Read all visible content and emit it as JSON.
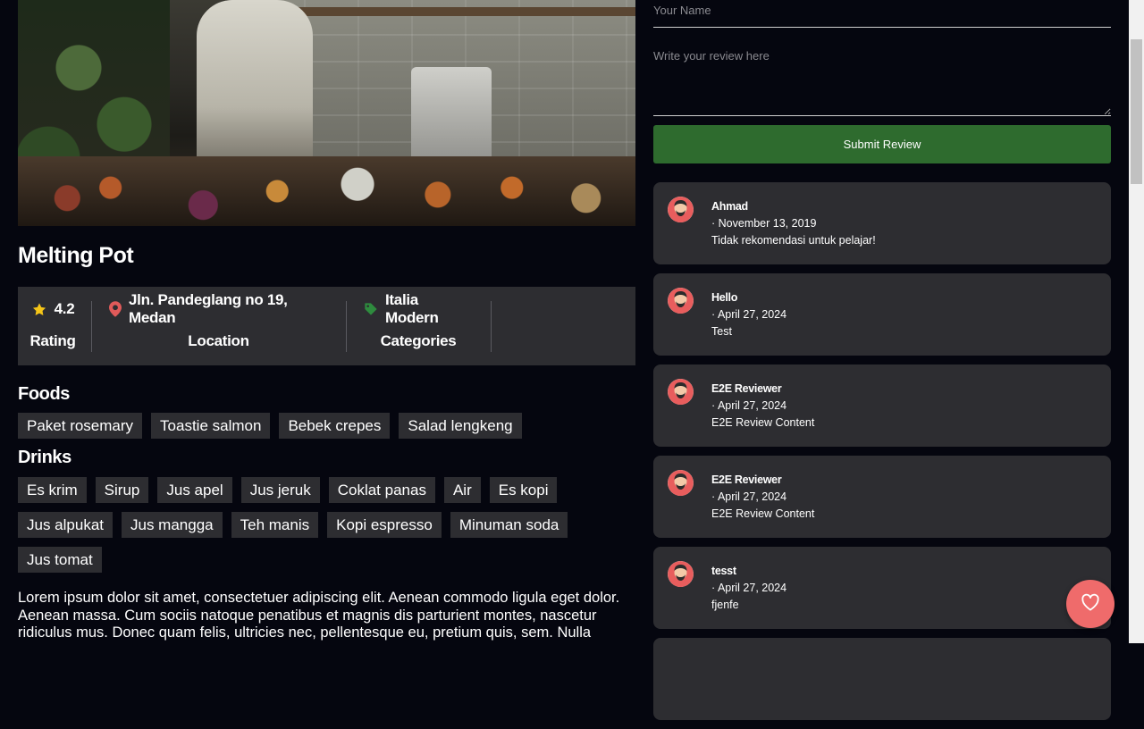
{
  "restaurant": {
    "name": "Melting Pot",
    "rating": "4.2",
    "rating_label": "Rating",
    "address": "Jln. Pandeglang no 19, Medan",
    "location_label": "Location",
    "category": "Italia Modern",
    "categories_label": "Categories",
    "description": "Lorem ipsum dolor sit amet, consectetuer adipiscing elit. Aenean commodo ligula eget dolor. Aenean massa. Cum sociis natoque penatibus et magnis dis parturient montes, nascetur ridiculus mus. Donec quam felis, ultricies nec, pellentesque eu, pretium quis, sem. Nulla"
  },
  "menu": {
    "foods_heading": "Foods",
    "foods": [
      "Paket rosemary",
      "Toastie salmon",
      "Bebek crepes",
      "Salad lengkeng"
    ],
    "drinks_heading": "Drinks",
    "drinks": [
      "Es krim",
      "Sirup",
      "Jus apel",
      "Jus jeruk",
      "Coklat panas",
      "Air",
      "Es kopi",
      "Jus alpukat",
      "Jus mangga",
      "Teh manis",
      "Kopi espresso",
      "Minuman soda",
      "Jus tomat"
    ]
  },
  "review_form": {
    "name_placeholder": "Your Name",
    "review_placeholder": "Write your review here",
    "submit_label": "Submit Review"
  },
  "reviews": [
    {
      "name": "Ahmad",
      "date": "· November 13, 2019",
      "text": "Tidak rekomendasi untuk pelajar!"
    },
    {
      "name": "Hello",
      "date": "· April 27, 2024",
      "text": "Test"
    },
    {
      "name": "E2E Reviewer",
      "date": "· April 27, 2024",
      "text": "E2E Review Content"
    },
    {
      "name": "E2E Reviewer",
      "date": "· April 27, 2024",
      "text": "E2E Review Content"
    },
    {
      "name": "tesst",
      "date": "· April 27, 2024",
      "text": "fjenfe"
    }
  ],
  "colors": {
    "background": "#05060f",
    "card": "#2d2d31",
    "submit": "#2e6b2e",
    "star": "#f5c518",
    "pin": "#e05a5a",
    "tag_icon": "#2e8b3e",
    "favorite": "#ef6b6b"
  },
  "icons": {
    "rating": "star-icon",
    "location": "map-pin-icon",
    "category": "tag-icon",
    "favorite": "heart-icon",
    "avatar": "avatar-icon"
  }
}
